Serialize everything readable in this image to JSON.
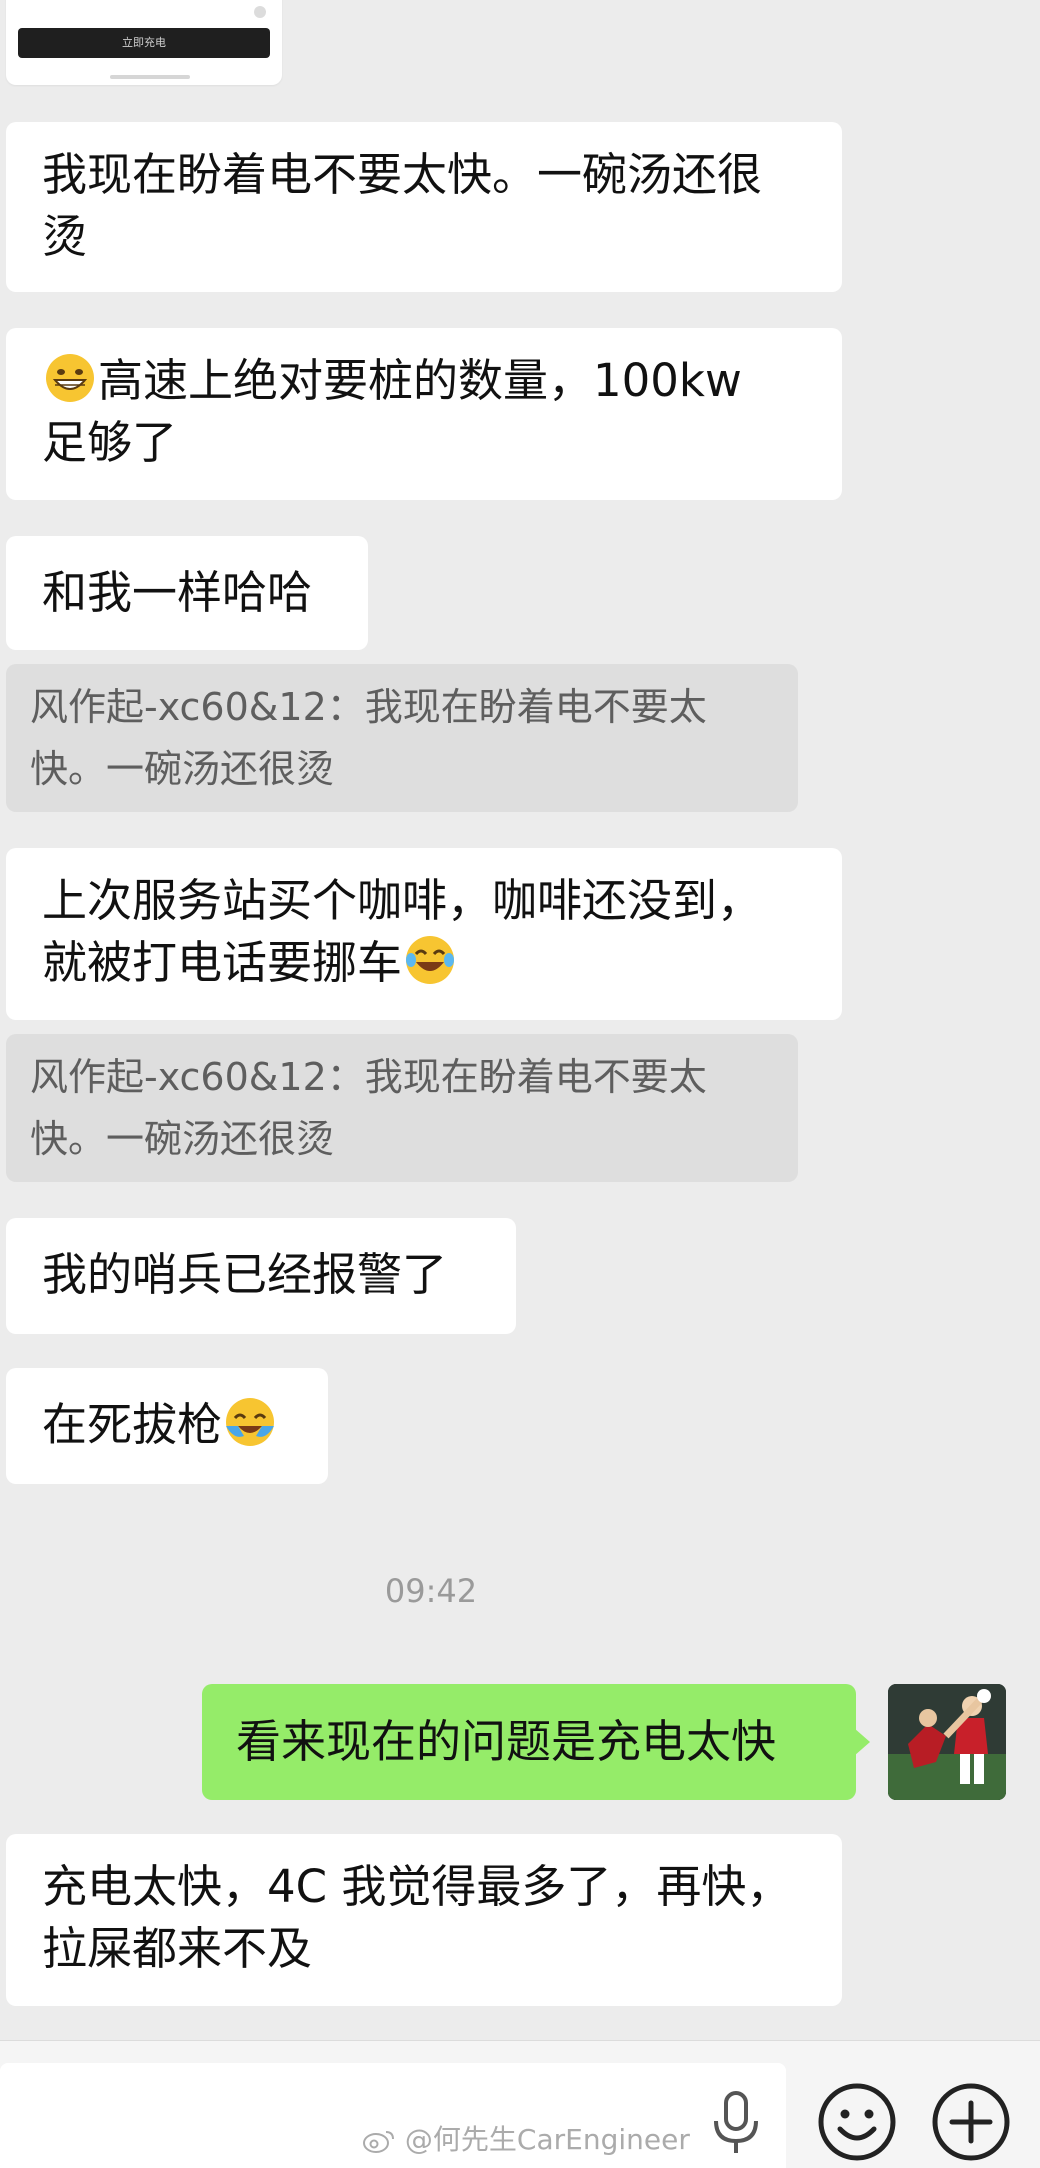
{
  "top_card": {
    "button_label": "立即充电"
  },
  "messages": [
    {
      "text": "我现在盼着电不要太快。一碗汤还很\n烫"
    },
    {
      "emoji": "grinning-face-emoji",
      "text": "高速上绝对要桩的数量，100kw\n足够了"
    },
    {
      "text": "和我一样哈哈"
    },
    {
      "quote": "风作起-xc60&12：我现在盼着电不要太\n快。一碗汤还很烫"
    },
    {
      "text_line1": "上次服务站买个咖啡，咖啡还没到，",
      "text_line2": "就被打电话要挪车",
      "emoji": "laughing-tears-emoji"
    },
    {
      "quote": "风作起-xc60&12：我现在盼着电不要太\n快。一碗汤还很烫"
    },
    {
      "text": "我的哨兵已经报警了"
    },
    {
      "text": "在死拔枪",
      "emoji": "crying-laughing-emoji"
    },
    {
      "text_line1": "充电太快，4C 我觉得最多了，再快，",
      "text_line2": "拉屎都来不及"
    }
  ],
  "timestamp": "09:42",
  "sent_message": "看来现在的问题是充电太快",
  "input_bar": {
    "voice_icon": "microphone-icon",
    "emoji_icon": "smiley-icon",
    "more_icon": "plus-circle-icon"
  },
  "watermark": "@何先生CarEngineer",
  "colors": {
    "background": "#ececec",
    "incoming_bubble": "#ffffff",
    "quote_bubble": "#dedede",
    "outgoing_bubble": "#95ec69",
    "timestamp": "#9a9a9a"
  }
}
